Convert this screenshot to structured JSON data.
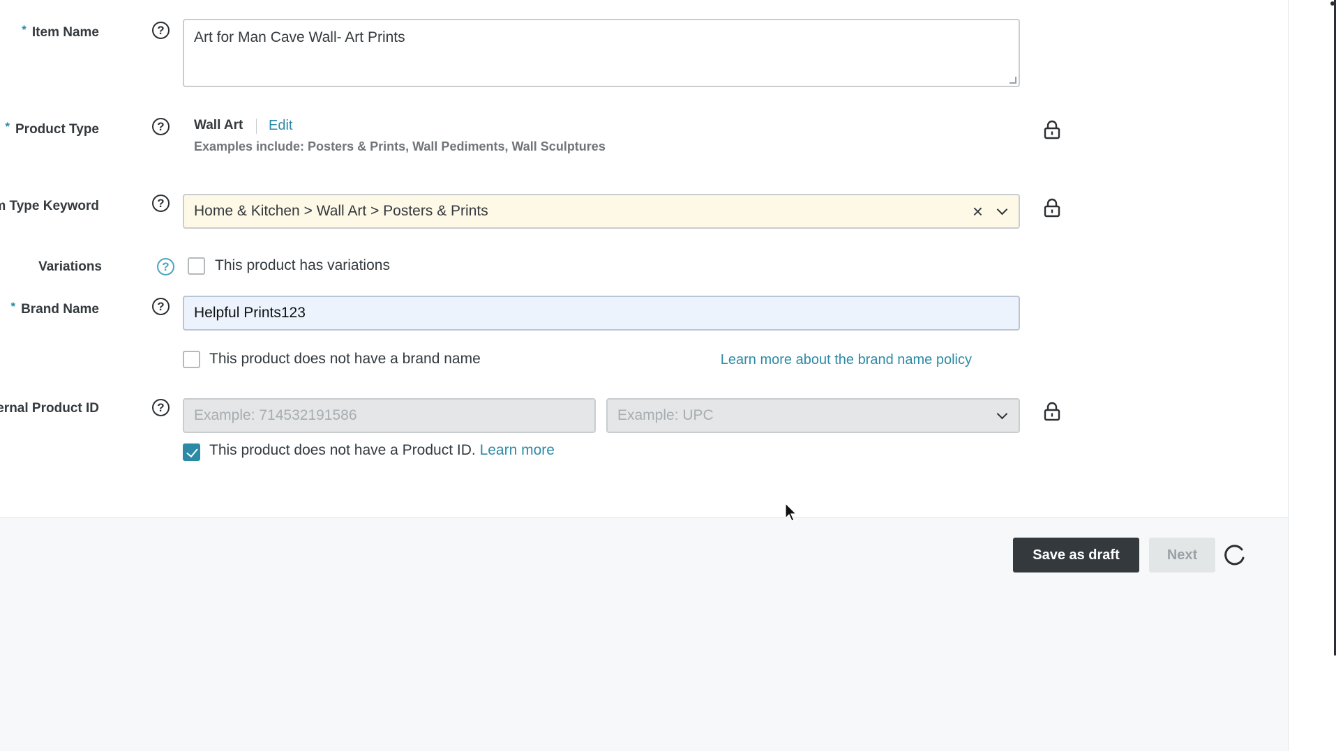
{
  "form": {
    "item_name": {
      "label": "Item Name",
      "required_mark": "*",
      "help": "?",
      "value": "Art for Man Cave Wall- Art Prints"
    },
    "product_type": {
      "label": "Product Type",
      "required_mark": "*",
      "help": "?",
      "value": "Wall Art",
      "edit_label": "Edit",
      "examples": "Examples include: Posters & Prints, Wall Pediments, Wall Sculptures"
    },
    "item_type_keyword": {
      "label": "Item Type Keyword",
      "required_mark": "*",
      "help": "?",
      "value": "Home & Kitchen > Wall Art > Posters & Prints",
      "clear_glyph": "×"
    },
    "variations": {
      "label": "Variations",
      "help": "?",
      "checkbox_label": "This product has variations",
      "checked": false
    },
    "brand_name": {
      "label": "Brand Name",
      "required_mark": "*",
      "help": "?",
      "value": "Helpful Prints123",
      "no_brand_label": "This product does not have a brand name",
      "no_brand_checked": false,
      "policy_link": "Learn more about the brand name policy"
    },
    "external_product_id": {
      "label": "External Product ID",
      "help": "?",
      "id_placeholder": "Example: 714532191586",
      "type_placeholder": "Example: UPC",
      "no_id_label": "This product does not have a Product ID.",
      "no_id_link": "Learn more",
      "no_id_checked": true
    }
  },
  "footer": {
    "save_draft_label": "Save as draft",
    "next_label": "Next"
  },
  "colors": {
    "accent": "#2b8aa5",
    "primary_button": "#33393d",
    "highlight_field": "#fef8e7",
    "focus_field": "#edf3fc"
  }
}
